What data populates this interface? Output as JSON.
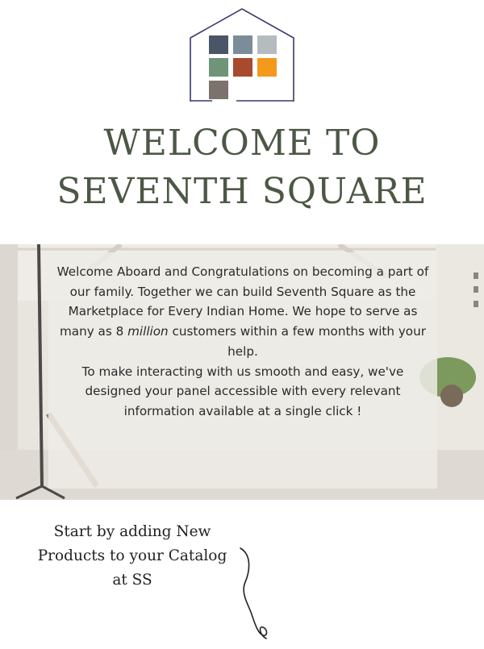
{
  "logo": {
    "icon": "house-with-color-grid-icon",
    "outline_color": "#3a3870",
    "tile_colors": [
      "#4a5667",
      "#7a8d99",
      "#b5bcc0",
      "#6f9478",
      "#a84a2e",
      "#f39a1c",
      "#7c716d"
    ]
  },
  "header": {
    "title_line1": "WELCOME TO",
    "title_line2": "SEVENTH SQUARE",
    "title_color": "#4c5845"
  },
  "intro": {
    "p1_a": "Welcome Aboard and Congratulations on becoming a part of our family. Together we can build Seventh Square as the Marketplace for Every Indian Home. We hope to serve as many as 8 ",
    "p1_italic": "million",
    "p1_b": " customers within a few months with your help.",
    "p2": "To make interacting with us smooth and easy, we've designed your panel accessible with every relevant information available at a single click !"
  },
  "cta": {
    "line1": "Start by adding New",
    "line2": "Products to your Catalog",
    "line3": "at SS",
    "arrow_icon": "curly-arrow-down-icon"
  }
}
